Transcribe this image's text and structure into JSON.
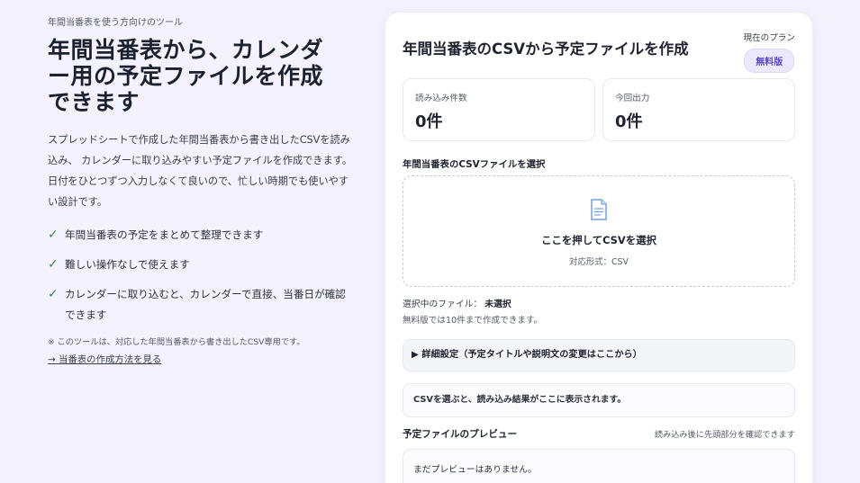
{
  "intro": {
    "eyebrow": "年間当番表を使う方向けのツール",
    "title_lines": [
      "年間当番表から、カレンダ",
      "ー用の予定ファイルを作成",
      "できます"
    ],
    "lead": "スプレッドシートで作成した年間当番表から書き出したCSVを読み込み、 カレンダーに取り込みやすい予定ファイルを作成できます。 日付をひとつずつ入力しなくて良いので、忙しい時期でも使いやすい設計です。",
    "features": [
      "年間当番表の予定をまとめて整理できます",
      "難しい操作なしで使えます",
      "カレンダーに取り込むと、カレンダーで直接、当番日が確認できます"
    ],
    "check_glyph": "✓",
    "note": "※ このツールは、対応した年間当番表から書き出したCSV専用です。",
    "how_link": "→ 当番表の作成方法を見る"
  },
  "card": {
    "title": "年間当番表のCSVから予定ファイルを作成",
    "plan_label": "現在のプラン",
    "plan_badge": "無料版",
    "stats": [
      {
        "label": "読み込み件数",
        "value": "0件"
      },
      {
        "label": "今回出力",
        "value": "0件"
      }
    ],
    "upload_label": "年間当番表のCSVファイルを選択",
    "dropzone_icon": "document-icon",
    "dropzone_title": "ここを押してCSVを選択",
    "dropzone_sub": "対応形式：CSV",
    "selected_prefix": "選択中のファイル：",
    "selected_value": "未選択",
    "limit_text": "無料版では10件まで作成できます。",
    "details_toggle": "▶ 詳細設定（予定タイトルや説明文の変更はここから）",
    "result_text": "CSVを選ぶと、読み込み結果がここに表示されます。",
    "preview_title": "予定ファイルのプレビュー",
    "preview_hint": "読み込み後に先頭部分を確認できます",
    "preview_empty": "まだプレビューはありません。"
  },
  "colors": {
    "background": "#f3f2fd",
    "accent": "#5b47c9",
    "check": "#3d8a4f",
    "doc_icon": "#6fa3e8"
  }
}
